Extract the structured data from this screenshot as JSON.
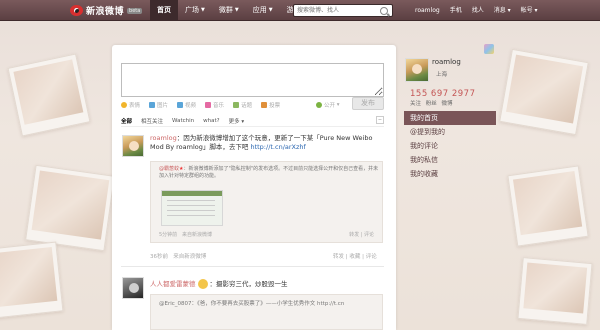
{
  "brand": {
    "name": "新浪微博",
    "beta": "beta"
  },
  "nav": [
    {
      "label": "首页",
      "active": true,
      "caret": false
    },
    {
      "label": "广场",
      "active": false,
      "caret": true
    },
    {
      "label": "微群",
      "active": false,
      "caret": true
    },
    {
      "label": "应用",
      "active": false,
      "caret": true
    },
    {
      "label": "游戏",
      "active": false,
      "caret": true
    }
  ],
  "search": {
    "placeholder": "搜索微博、找人"
  },
  "user_links": [
    "roamlog",
    "手机",
    "找人",
    "消息 ▾",
    "帐号 ▾"
  ],
  "composer": {
    "tools": [
      {
        "label": "表情",
        "color": "#f1b52c"
      },
      {
        "label": "图片",
        "color": "#5aa5d8"
      },
      {
        "label": "视频",
        "color": "#5aa5d8"
      },
      {
        "label": "音乐",
        "color": "#e56aa3"
      },
      {
        "label": "话题",
        "color": "#8cb860"
      },
      {
        "label": "投票",
        "color": "#e0903a"
      }
    ],
    "visibility": "公开",
    "send_label": "发布"
  },
  "filters": [
    "全部",
    "相互关注",
    "Watchin",
    "what?",
    "更多 ▾"
  ],
  "filter_toggle": "−",
  "post1": {
    "user": "roamlog",
    "text": "：因为新浪微博增加了这个玩意，更新了一下某「Pure New Weibo Mod By roamlog」脚本，去下吧",
    "link": "http://t.cn/arXzhf",
    "repost": {
      "user": "@霸葱蚊",
      "text": "：新浪微博新添加了\"隐私控制\"的发布选项。不过目前只能选择公开和仅自己查看，并未加入针对特定群组的功能。",
      "time": "5分钟前",
      "from": "来自新浪微博",
      "actions": "转发 | 评论"
    },
    "time": "36秒前",
    "from": "来自新浪微博",
    "actions": "转发 | 收藏 | 评论"
  },
  "post2": {
    "user": "人人都爱雷蒙德",
    "text": "：摄影穷三代，炒股毁一生",
    "repost_text": "@Eric_0807：《爸，你不要再去买股票了》——小学生优秀作文 http://t.cn"
  },
  "profile": {
    "name": "roamlog",
    "location": "上海",
    "stats": "155  697  2977",
    "stat_labels": "关注  粉丝  微博"
  },
  "menu": [
    {
      "label": "我的首页",
      "active": true
    },
    {
      "label": "@提到我的",
      "active": false
    },
    {
      "label": "我的评论",
      "active": false
    },
    {
      "label": "我的私信",
      "active": false
    },
    {
      "label": "我的收藏",
      "active": false
    }
  ]
}
